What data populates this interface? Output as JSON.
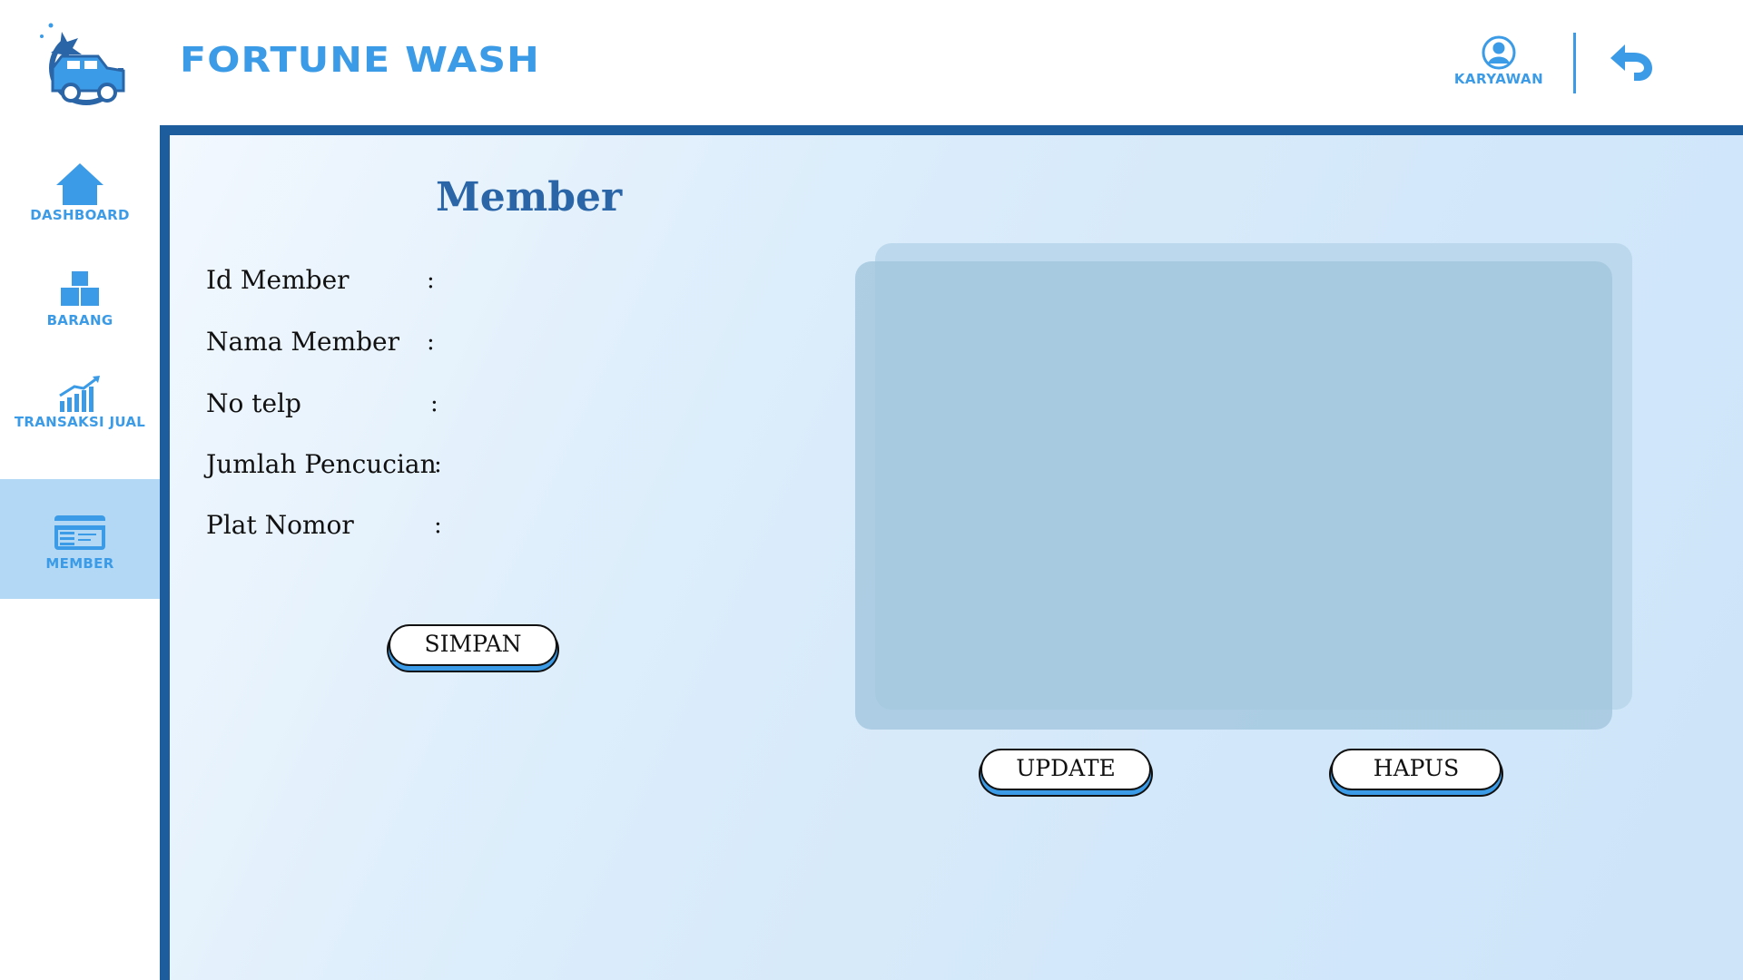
{
  "header": {
    "brand": "FORTUNE WASH",
    "user_label": "KARYAWAN",
    "logo_icon": "car-wash-logo-icon",
    "user_icon": "user-circle-icon",
    "back_icon": "undo-arrow-icon"
  },
  "sidebar": {
    "items": [
      {
        "label": "DASHBOARD",
        "icon": "home-icon",
        "active": false
      },
      {
        "label": "BARANG",
        "icon": "boxes-icon",
        "active": false
      },
      {
        "label": "TRANSAKSI JUAL",
        "icon": "growth-chart-icon",
        "active": false
      },
      {
        "label": "MEMBER",
        "icon": "member-card-icon",
        "active": true
      }
    ]
  },
  "main": {
    "title": "Member",
    "fields": [
      {
        "label": "Id Member",
        "separator": ":"
      },
      {
        "label": "Nama Member",
        "separator": ":"
      },
      {
        "label": "No telp",
        "separator": ":"
      },
      {
        "label": "Jumlah Pencucian",
        "separator": ":"
      },
      {
        "label": "Plat Nomor",
        "separator": ":"
      }
    ],
    "save_button": "SIMPAN",
    "update_button": "UPDATE",
    "delete_button": "HAPUS"
  },
  "colors": {
    "accent": "#3b9be6",
    "panel_border": "#1d5d9e",
    "title": "#2a65a8",
    "active_nav": "#b3d8f6"
  }
}
